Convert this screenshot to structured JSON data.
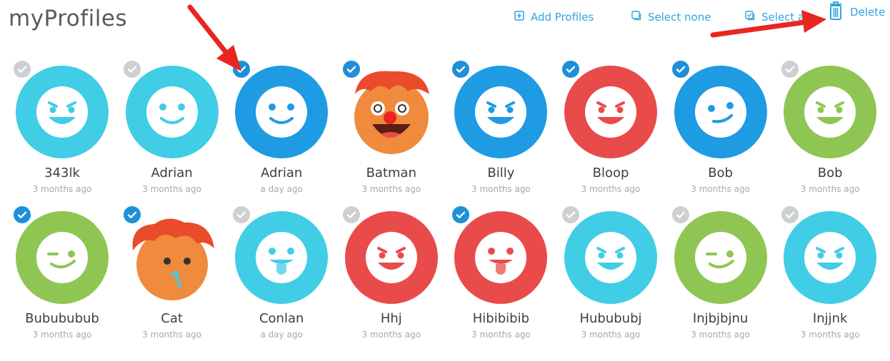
{
  "header": {
    "title": "myProfiles",
    "actions": {
      "add": "Add Profiles",
      "select_none": "Select none",
      "select_all": "Select all",
      "delete": "Delete"
    }
  },
  "colors": {
    "accent": "#2fa6df",
    "cyan": "#41cde6",
    "blue": "#1e9be3",
    "red": "#e94b4b",
    "green": "#8fc653",
    "orange": "#f08a3c",
    "check_on": "#1e8fd9",
    "check_off": "#cdcfd1",
    "annotation_arrow": "#e8261f"
  },
  "profiles": [
    {
      "name": "343lk",
      "time": "3 months ago",
      "color": "cyan",
      "face": "angry",
      "selected": false
    },
    {
      "name": "Adrian",
      "time": "3 months ago",
      "color": "cyan",
      "face": "smile",
      "selected": false
    },
    {
      "name": "Adrian",
      "time": "a day ago",
      "color": "blue",
      "face": "smile",
      "selected": true
    },
    {
      "name": "Batman",
      "time": "3 months ago",
      "color": "orange",
      "face": "clown",
      "selected": true
    },
    {
      "name": "Billy",
      "time": "3 months ago",
      "color": "blue",
      "face": "angry",
      "selected": true
    },
    {
      "name": "Bloop",
      "time": "3 months ago",
      "color": "red",
      "face": "angry",
      "selected": true
    },
    {
      "name": "Bob",
      "time": "3 months ago",
      "color": "blue",
      "face": "smirk",
      "selected": true
    },
    {
      "name": "Bob",
      "time": "3 months ago",
      "color": "green",
      "face": "angry",
      "selected": false
    },
    {
      "name": "Bubububub",
      "time": "3 months ago",
      "color": "green",
      "face": "wink",
      "selected": true
    },
    {
      "name": "Cat",
      "time": "3 months ago",
      "color": "orange",
      "face": "kiss",
      "selected": true
    },
    {
      "name": "Conlan",
      "time": "a day ago",
      "color": "cyan",
      "face": "tongue",
      "selected": false
    },
    {
      "name": "Hhj",
      "time": "3 months ago",
      "color": "red",
      "face": "angry",
      "selected": false
    },
    {
      "name": "Hibibibib",
      "time": "3 months ago",
      "color": "red",
      "face": "tongue",
      "selected": true
    },
    {
      "name": "Hubububj",
      "time": "3 months ago",
      "color": "cyan",
      "face": "angry",
      "selected": false
    },
    {
      "name": "Injbjbjnu",
      "time": "3 months ago",
      "color": "green",
      "face": "wink",
      "selected": false
    },
    {
      "name": "Injjnk",
      "time": "3 months ago",
      "color": "cyan",
      "face": "angry",
      "selected": false
    }
  ],
  "icons": {
    "add": "plus-square-icon",
    "select_none": "empty-square-icon",
    "select_all": "checked-square-icon",
    "delete": "trash-icon",
    "check": "checkmark-icon"
  }
}
